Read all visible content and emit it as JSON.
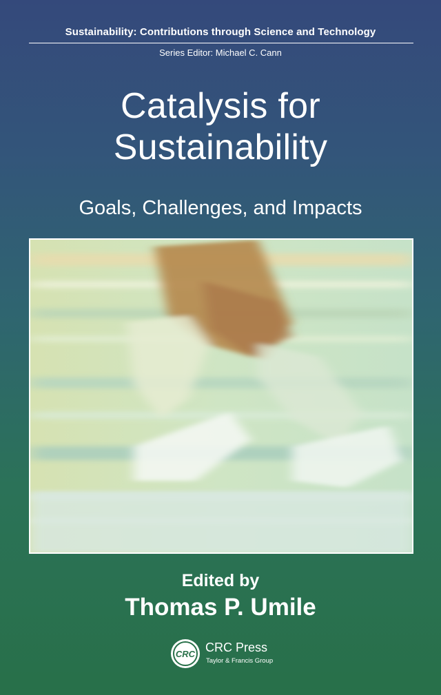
{
  "series": {
    "title": "Sustainability: Contributions through Science and Technology",
    "editor": "Series Editor: Michael C. Cann"
  },
  "book": {
    "title_line1": "Catalysis for",
    "title_line2": "Sustainability",
    "subtitle": "Goals, Challenges, and Impacts"
  },
  "credits": {
    "edited_by": "Edited by",
    "editor_name": "Thomas P. Umile"
  },
  "publisher": {
    "logo_text": "CRC",
    "name": "CRC Press",
    "group": "Taylor & Francis Group"
  },
  "colors": {
    "top": "#34497b",
    "bottom": "#287049",
    "text": "#ffffff"
  }
}
